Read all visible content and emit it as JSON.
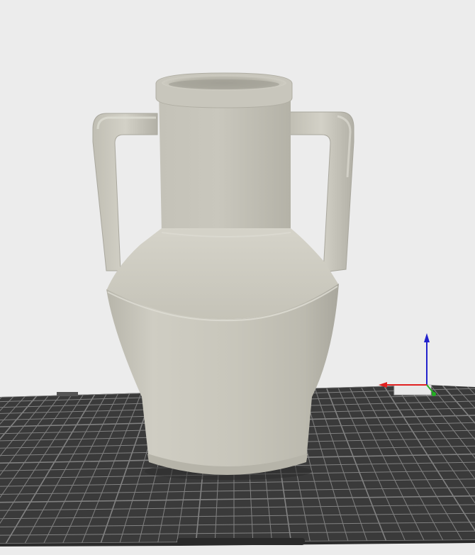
{
  "viewport": {
    "background_color": "#ececec"
  },
  "build_plate": {
    "surface_color": "#3a3a3a",
    "grid_color": "#8a8a8a",
    "label": "",
    "icon": "textured-build-plate"
  },
  "model": {
    "icon": "amphora-vase-icon",
    "color": "#cfcdc2"
  },
  "axes_gizmo": {
    "x_axis_color": "#e02020",
    "y_axis_color": "#22b022",
    "z_axis_color": "#2222cc"
  }
}
